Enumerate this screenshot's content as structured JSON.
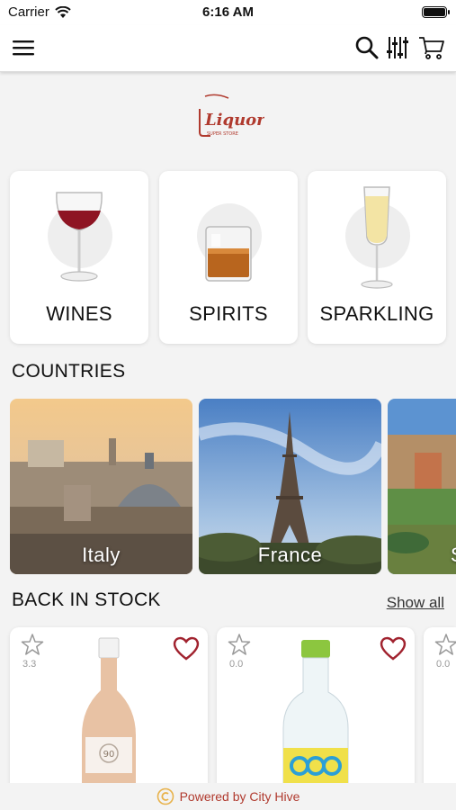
{
  "status_bar": {
    "carrier": "Carrier",
    "time": "6:16 AM"
  },
  "logo": {
    "text": "Liquor",
    "sub": "SUPER STORE"
  },
  "categories": [
    {
      "label": "WINES"
    },
    {
      "label": "SPIRITS"
    },
    {
      "label": "SPARKLING"
    }
  ],
  "countries_section": {
    "title": "COUNTRIES"
  },
  "countries": [
    {
      "label": "Italy"
    },
    {
      "label": "France"
    },
    {
      "label": "S"
    }
  ],
  "back_in_stock": {
    "title": "BACK IN STOCK",
    "show_all": "Show all"
  },
  "products": [
    {
      "rating": "3.3",
      "label_text": "90"
    },
    {
      "rating": "0.0"
    },
    {
      "rating": "0.0"
    }
  ],
  "footer": {
    "text": "Powered by City Hive"
  },
  "colors": {
    "accent": "#b03a2e",
    "background": "#f3f3f3"
  }
}
